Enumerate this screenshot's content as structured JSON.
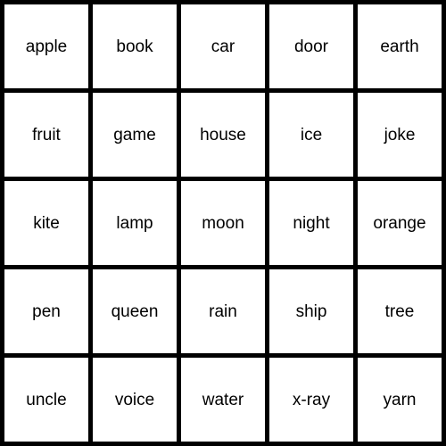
{
  "board": {
    "rows": [
      [
        "apple",
        "book",
        "car",
        "door",
        "earth"
      ],
      [
        "fruit",
        "game",
        "house",
        "ice",
        "joke"
      ],
      [
        "kite",
        "lamp",
        "moon",
        "night",
        "orange"
      ],
      [
        "pen",
        "queen",
        "rain",
        "ship",
        "tree"
      ],
      [
        "uncle",
        "voice",
        "water",
        "x-ray",
        "yarn"
      ]
    ]
  },
  "colors": {
    "grid_line": "#000000",
    "cell_background": "#ffffff",
    "text": "#000000"
  }
}
